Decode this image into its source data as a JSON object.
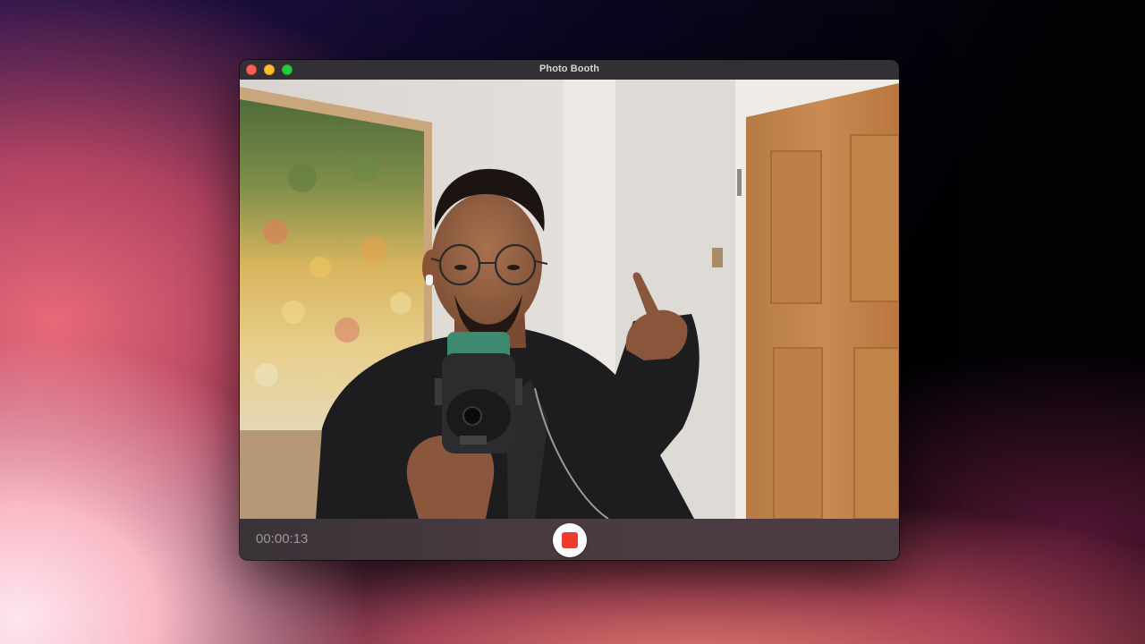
{
  "window": {
    "title": "Photo Booth"
  },
  "controls": {
    "elapsed_time": "00:00:13",
    "record_button_state": "recording",
    "stop_icon": "stop-icon"
  },
  "colors": {
    "record_red": "#ee3b2f",
    "traffic_close": "#fe5f57",
    "traffic_minimize": "#febc2e",
    "traffic_zoom": "#28c840"
  }
}
